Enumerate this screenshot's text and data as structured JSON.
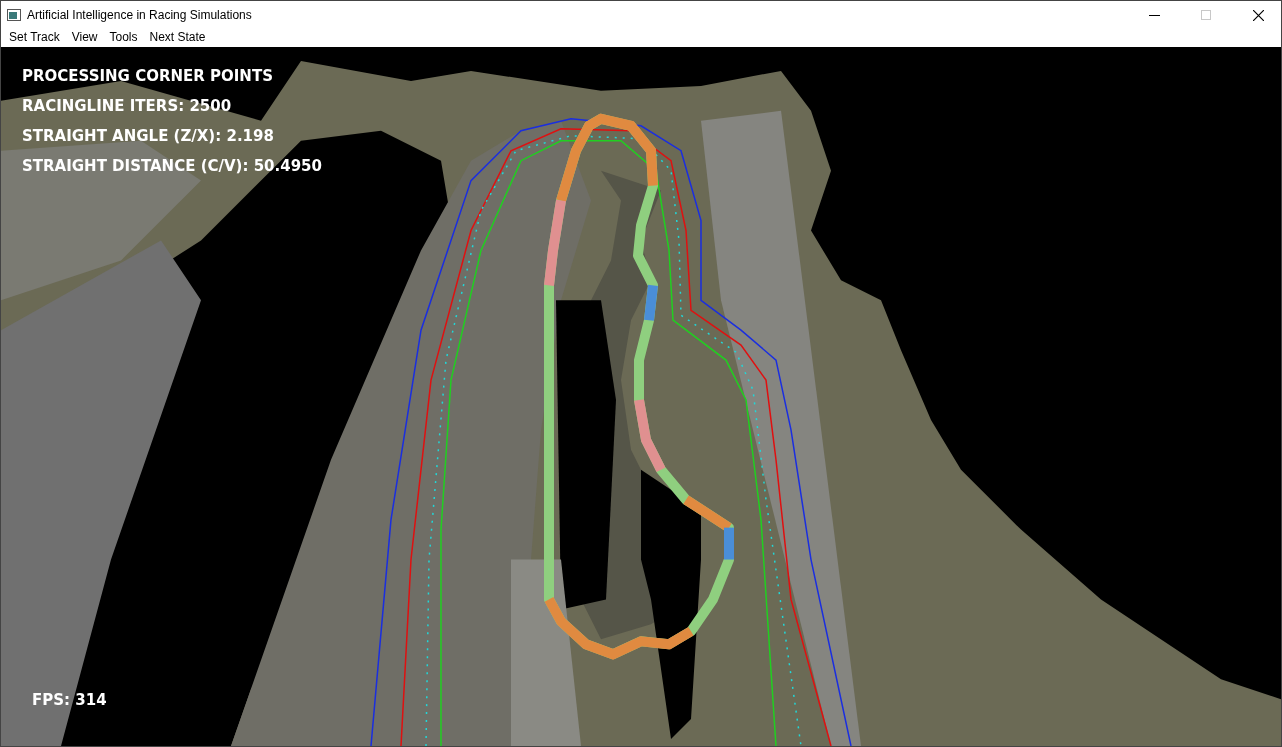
{
  "window": {
    "title": "Artificial Intelligence in Racing Simulations",
    "controls": [
      {
        "kind": "minimize",
        "disabled": false
      },
      {
        "kind": "maximize",
        "disabled": true
      },
      {
        "kind": "close",
        "disabled": false
      }
    ]
  },
  "menu": [
    "Set Track",
    "View",
    "Tools",
    "Next State"
  ],
  "overlay": {
    "status_lines": [
      "PROCESSING CORNER POINTS",
      "RACINGLINE ITERS: 2500",
      "STRAIGHT ANGLE (Z/X): 2.198",
      "STRAIGHT DISTANCE (C/V): 50.4950"
    ],
    "fps": "FPS: 314"
  }
}
